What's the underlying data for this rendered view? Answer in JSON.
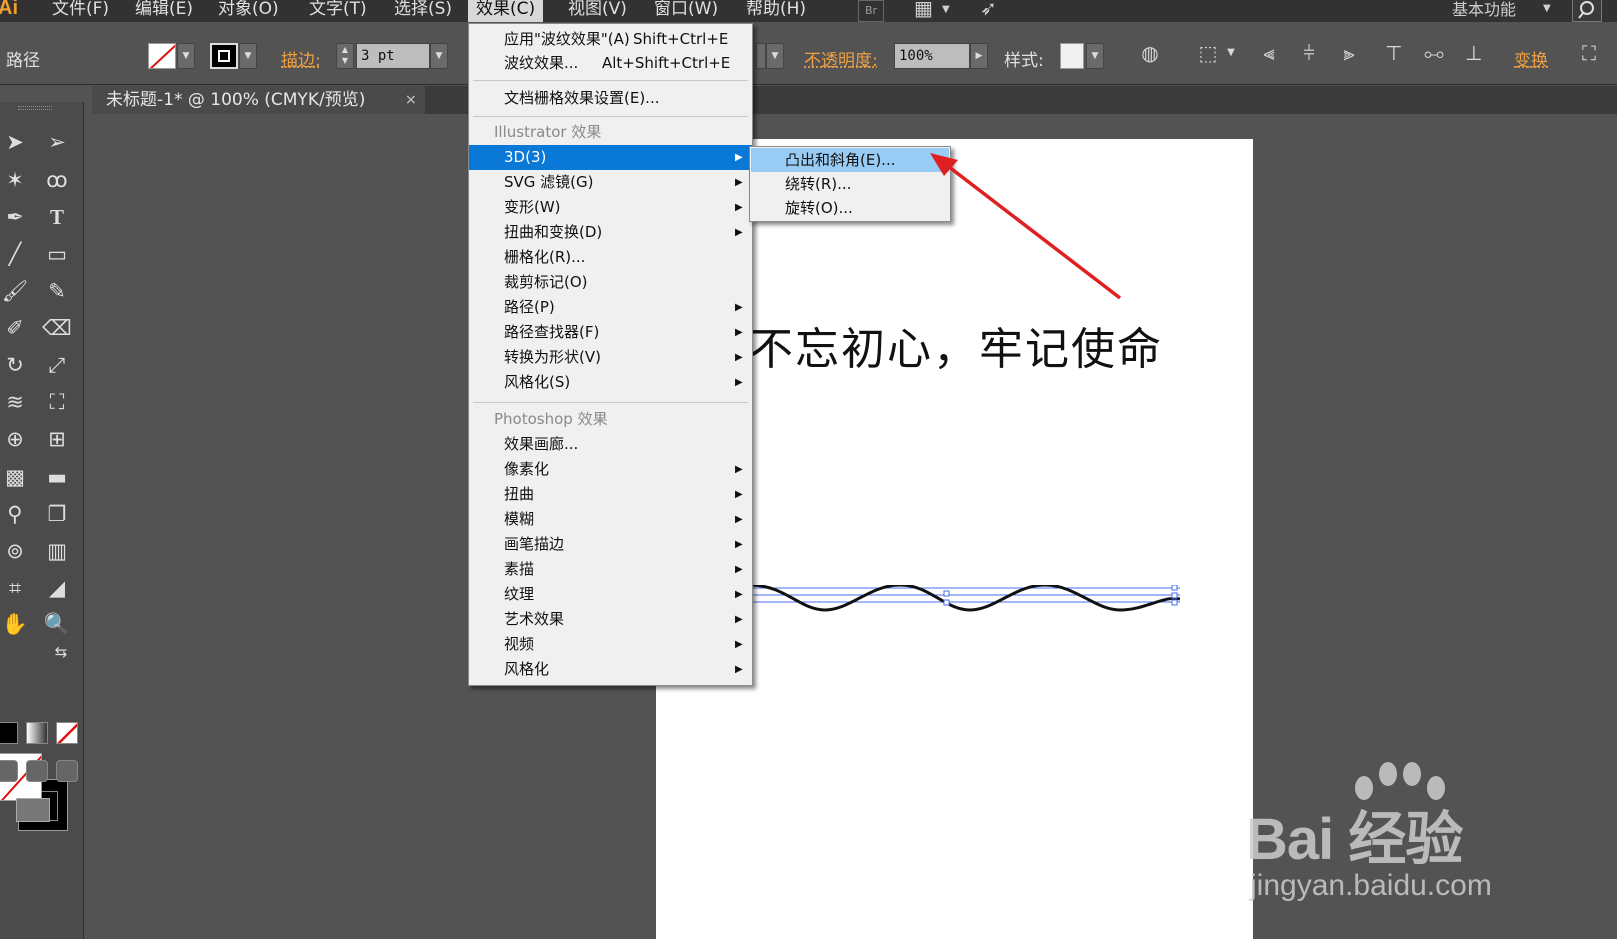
{
  "app": {
    "logo": "Ai"
  },
  "menubar": {
    "menus": [
      "文件(F)",
      "编辑(E)",
      "对象(O)",
      "文字(T)",
      "选择(S)",
      "效果(C)",
      "视图(V)",
      "窗口(W)",
      "帮助(H)"
    ],
    "open_menu": "效果(C)",
    "bridge_label": "Br",
    "workspace": "基本功能"
  },
  "controlbar": {
    "object_type": "路径",
    "stroke_label": "描边:",
    "stroke_value": "3 pt",
    "opacity_label": "不透明度:",
    "opacity_value": "100%",
    "style_label": "样式:",
    "transform_label": "变换"
  },
  "document_tab": {
    "title": "未标题-1* @ 100% (CMYK/预览)",
    "close": "×"
  },
  "effect_menu": {
    "apply_last": {
      "label": "应用\"波纹效果\"(A)",
      "shortcut": "Shift+Ctrl+E"
    },
    "last_effect": {
      "label": "波纹效果...",
      "shortcut": "Alt+Shift+Ctrl+E"
    },
    "raster_settings": "文档栅格效果设置(E)...",
    "illustrator_section": "Illustrator 效果",
    "illustrator_items": [
      "3D(3)",
      "SVG 滤镜(G)",
      "变形(W)",
      "扭曲和变换(D)",
      "栅格化(R)...",
      "裁剪标记(O)",
      "路径(P)",
      "路径查找器(F)",
      "转换为形状(V)",
      "风格化(S)"
    ],
    "photoshop_section": "Photoshop 效果",
    "photoshop_items": [
      "效果画廊...",
      "像素化",
      "扭曲",
      "模糊",
      "画笔描边",
      "素描",
      "纹理",
      "艺术效果",
      "视频",
      "风格化"
    ]
  },
  "submenu_3d": {
    "items": [
      "凸出和斜角(E)...",
      "绕转(R)...",
      "旋转(O)..."
    ]
  },
  "canvas": {
    "text": "不忘初心，牢记使命"
  },
  "watermark": {
    "logo": "Bai 经验",
    "url": "jingyan.baidu.com"
  },
  "colors": {
    "menu_highlight": "#0a78d7",
    "submenu_highlight": "#99ccf5",
    "annotation": "#e02020",
    "label_orange": "#f0a042"
  }
}
